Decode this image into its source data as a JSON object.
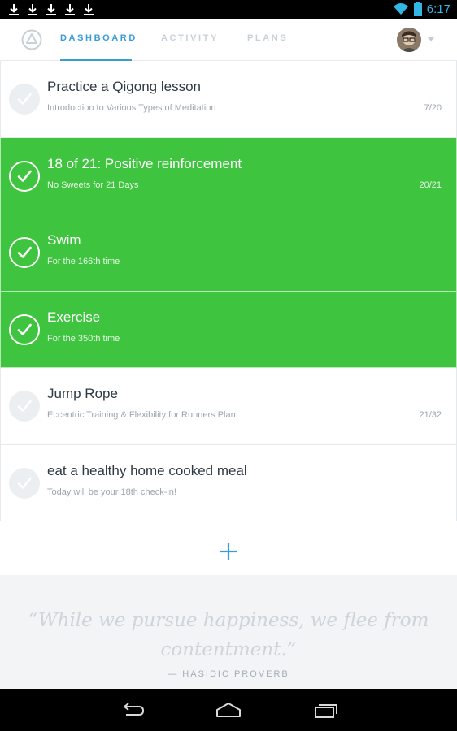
{
  "status_bar": {
    "time": "6:17",
    "notification_icons": [
      "download-icon",
      "download-icon",
      "download-icon",
      "download-icon",
      "download-icon"
    ]
  },
  "nav": {
    "tabs": [
      {
        "label": "DASHBOARD",
        "active": true
      },
      {
        "label": "ACTIVITY",
        "active": false
      },
      {
        "label": "PLANS",
        "active": false
      }
    ]
  },
  "items": [
    {
      "title": "Practice a Qigong lesson",
      "subtitle": "Introduction to Various Types of Meditation",
      "count": "7/20",
      "done": false
    },
    {
      "title": "18 of 21: Positive reinforcement",
      "subtitle": "No Sweets for 21 Days",
      "count": "20/21",
      "done": true
    },
    {
      "title": "Swim",
      "subtitle": "For the 166th time",
      "count": "",
      "done": true
    },
    {
      "title": "Exercise",
      "subtitle": "For the 350th time",
      "count": "",
      "done": true
    },
    {
      "title": "Jump Rope",
      "subtitle": "Eccentric Training & Flexibility for Runners Plan",
      "count": "21/32",
      "done": false
    },
    {
      "title": "eat a healthy home cooked meal",
      "subtitle": "Today will be your 18th check-in!",
      "count": "",
      "done": false
    }
  ],
  "quote": {
    "text": "“While we pursue happiness, we flee from contentment.”",
    "author": "— HASIDIC PROVERB"
  },
  "colors": {
    "accent": "#3a9bd9",
    "done_green": "#3ec43f",
    "status_time": "#33b5e5"
  }
}
